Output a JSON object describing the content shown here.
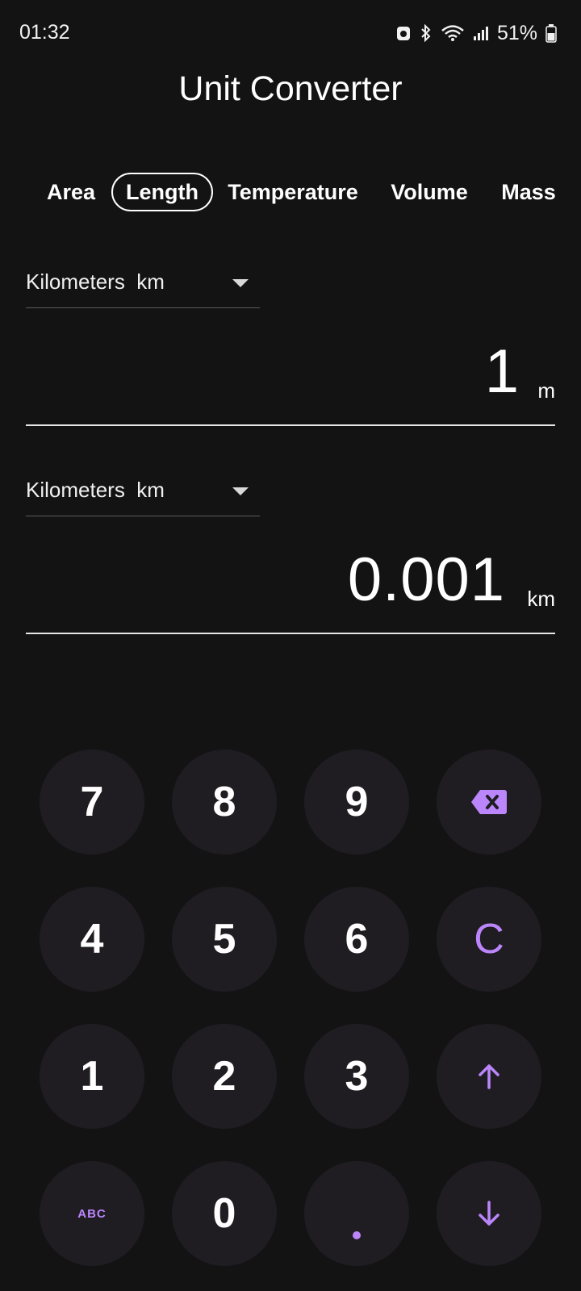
{
  "status": {
    "time": "01:32",
    "battery": "51%"
  },
  "app": {
    "title": "Unit Converter"
  },
  "tabs": [
    {
      "label": "Area",
      "active": false
    },
    {
      "label": "Length",
      "active": true
    },
    {
      "label": "Temperature",
      "active": false
    },
    {
      "label": "Volume",
      "active": false
    },
    {
      "label": "Mass",
      "active": false
    }
  ],
  "from": {
    "unit_label": "Kilometers  km",
    "value": "1",
    "unit_suffix": "m"
  },
  "to": {
    "unit_label": "Kilometers  km",
    "value": "0.001",
    "unit_suffix": "km"
  },
  "keypad": {
    "keys": [
      "7",
      "8",
      "9",
      "backspace-icon",
      "4",
      "5",
      "6",
      "C",
      "1",
      "2",
      "3",
      "arrow-up-icon",
      "ABC",
      "0",
      ".",
      "arrow-down-icon"
    ],
    "accent_color": "#bb86fc",
    "key_background": "#1f1d22"
  },
  "colors": {
    "background": "#141314",
    "accent": "#bb86fc"
  }
}
